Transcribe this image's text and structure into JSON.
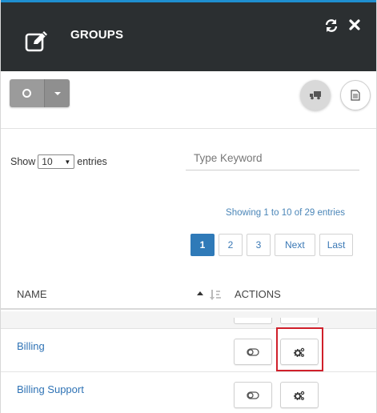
{
  "header": {
    "title": "GROUPS",
    "icons": {
      "edit": "edit-icon",
      "refresh": "refresh-icon",
      "close": "close-icon"
    }
  },
  "toolbar": {
    "toggle_icon": "circle-icon",
    "dropdown_icon": "caret-down-icon",
    "delivery_icon": "truck-icon",
    "document_icon": "document-icon"
  },
  "table_controls": {
    "show_label": "Show",
    "entries_value": "10",
    "entries_label": "entries",
    "search_placeholder": "Type Keyword",
    "info": "Showing 1 to 10 of 29 entries"
  },
  "pagination": {
    "pages": [
      "1",
      "2",
      "3"
    ],
    "active": "1",
    "next": "Next",
    "last": "Last"
  },
  "table": {
    "columns": {
      "name": "NAME",
      "actions": "ACTIONS"
    },
    "rows": [
      {
        "name": "Billing"
      },
      {
        "name": "Billing Support"
      }
    ]
  },
  "colors": {
    "header_bg": "#2b2f31",
    "accent": "#2f7ab8",
    "link": "#2f73b5",
    "highlight": "#d0202b"
  }
}
